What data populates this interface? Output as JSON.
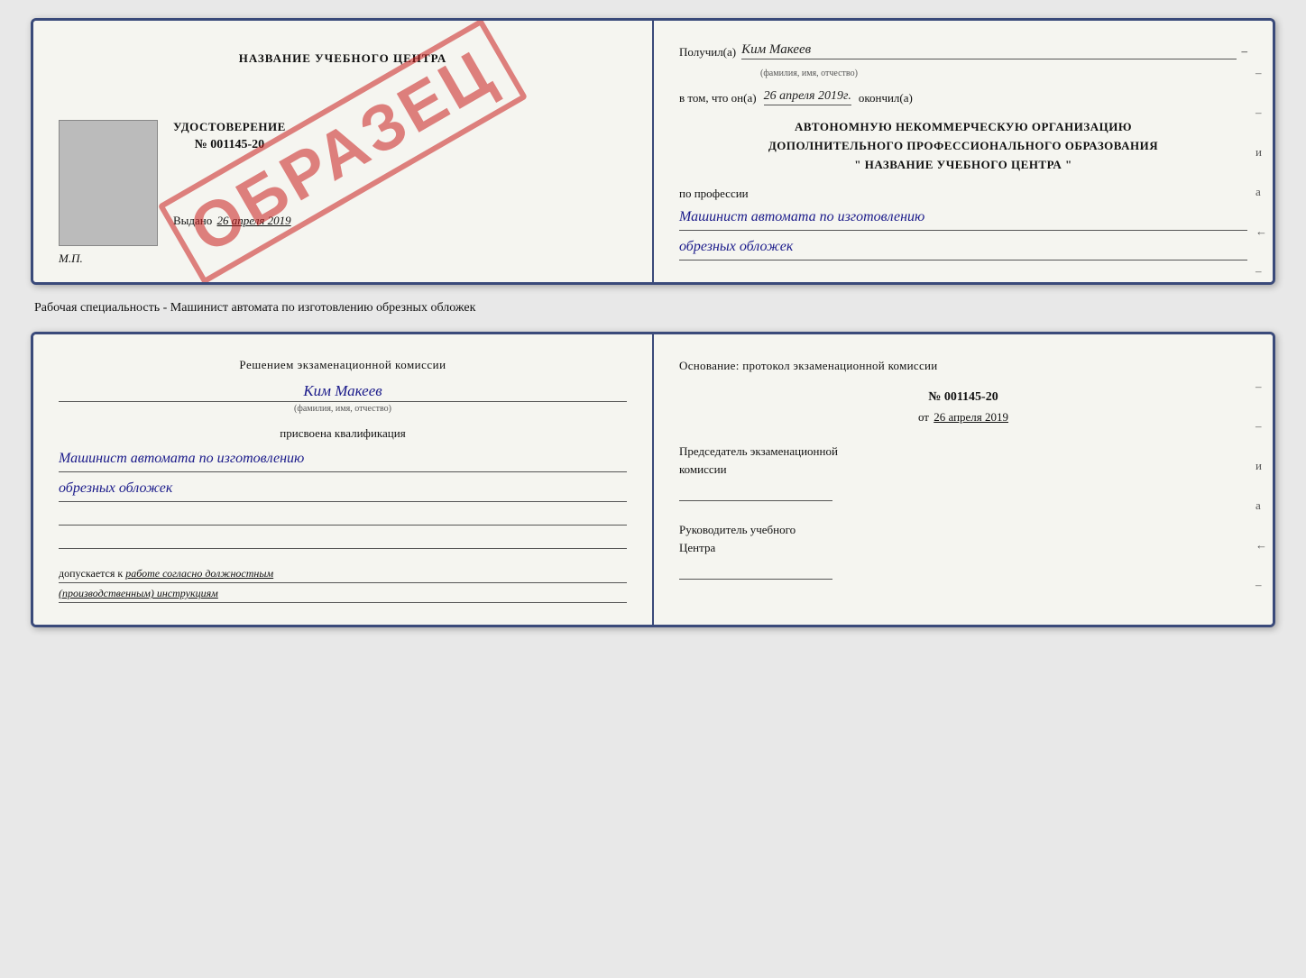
{
  "card1": {
    "left": {
      "cert_title": "НАЗВАНИЕ УЧЕБНОГО ЦЕНТРА",
      "cert_udost": "УДОСТОВЕРЕНИЕ",
      "cert_number": "№ 001145-20",
      "cert_date_label": "Выдано",
      "cert_date_value": "26 апреля 2019",
      "cert_mp": "М.П.",
      "stamp_text": "ОБРАЗЕЦ"
    },
    "right": {
      "received_label": "Получил(а)",
      "received_value": "Ким Макеев",
      "received_sub": "(фамилия, имя, отчество)",
      "date_label": "в том, что он(а)",
      "date_value": "26 апреля 2019г.",
      "date_suffix": "окончил(а)",
      "org_line1": "АВТОНОМНУЮ НЕКОММЕРЧЕСКУЮ ОРГАНИЗАЦИЮ",
      "org_line2": "ДОПОЛНИТЕЛЬНОГО ПРОФЕССИОНАЛЬНОГО ОБРАЗОВАНИЯ",
      "org_line3": "\"  НАЗВАНИЕ УЧЕБНОГО ЦЕНТРА  \"",
      "profession_label": "по профессии",
      "profession_line1": "Машинист автомата по изготовлению",
      "profession_line2": "обрезных обложек"
    }
  },
  "specialty_line": "Рабочая специальность - Машинист автомата по изготовлению обрезных обложек",
  "card2": {
    "left": {
      "decision_line1": "Решением экзаменационной  комиссии",
      "name_value": "Ким Макеев",
      "name_sub": "(фамилия, имя, отчество)",
      "assigned_label": "присвоена квалификация",
      "qualification_line1": "Машинист автомата по изготовлению",
      "qualification_line2": "обрезных обложек",
      "допускается_label": "допускается к",
      "допускается_value": "работе согласно должностным",
      "допускается_value2": "(производственным) инструкциям"
    },
    "right": {
      "osnov_label": "Основание: протокол экзаменационной  комиссии",
      "protocol_number": "№  001145-20",
      "protocol_date_prefix": "от",
      "protocol_date": "26 апреля 2019",
      "chair_label1": "Председатель экзаменационной",
      "chair_label2": "комиссии",
      "head_label1": "Руководитель учебного",
      "head_label2": "Центра"
    }
  }
}
